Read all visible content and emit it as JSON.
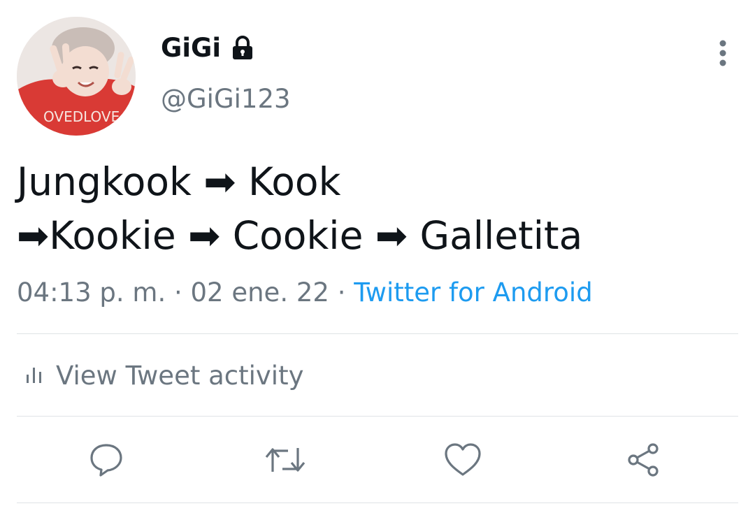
{
  "tweet": {
    "author": {
      "display_name": "GiGi",
      "handle": "@GiGi123",
      "avatar_print": "OVEDLOVE",
      "protected": true
    },
    "text_lines": [
      "Jungkook ➡ Kook",
      "➡Kookie ➡ Cookie ➡ Galletita"
    ],
    "meta": {
      "time": "04:13 p. m.",
      "separator": " · ",
      "date": "02 ene. 22",
      "source": "Twitter for Android"
    },
    "activity_label": "View Tweet activity",
    "actions": [
      "reply-icon",
      "retweet-icon",
      "like-icon",
      "share-icon"
    ]
  },
  "colors": {
    "text_primary": "#0f1419",
    "text_secondary": "#6b7680",
    "link": "#1d9bf0",
    "divider": "#dfe3e6"
  }
}
